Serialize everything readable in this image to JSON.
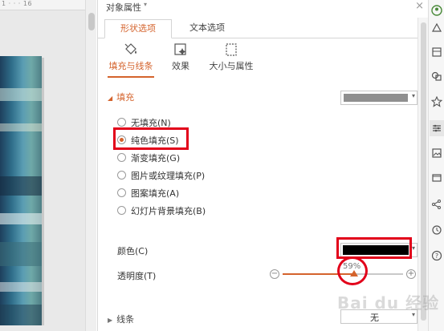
{
  "ruler": {
    "text": "1 · · · 16"
  },
  "panel": {
    "title": "对象属性",
    "title_arrow": "▾",
    "close": "×"
  },
  "tabs": [
    {
      "label": "形状选项",
      "active": true
    },
    {
      "label": "文本选项",
      "active": false
    }
  ],
  "subtabs": [
    {
      "label": "填充与线条",
      "icon": "fill-bucket-icon",
      "active": true
    },
    {
      "label": "效果",
      "icon": "effect-icon",
      "active": false
    },
    {
      "label": "大小与属性",
      "icon": "size-icon",
      "active": false
    }
  ],
  "fill_section": {
    "heading": "填充",
    "fill_swatch_color": "#8f8f8f",
    "options": [
      {
        "label": "无填充(N)",
        "checked": false
      },
      {
        "label": "纯色填充(S)",
        "checked": true
      },
      {
        "label": "渐变填充(G)",
        "checked": false
      },
      {
        "label": "图片或纹理填充(P)",
        "checked": false
      },
      {
        "label": "图案填充(A)",
        "checked": false
      },
      {
        "label": "幻灯片背景填充(B)",
        "checked": false
      }
    ],
    "color_label": "颜色(C)",
    "color_value": "#000000",
    "transparency_label": "透明度(T)",
    "transparency_value": "59%",
    "transparency_fraction": 0.59
  },
  "line_section": {
    "heading": "线条",
    "value": "无"
  },
  "colors": {
    "accent": "#d4632c",
    "highlight": "#e2001a"
  },
  "watermark": "Bai du 经验"
}
